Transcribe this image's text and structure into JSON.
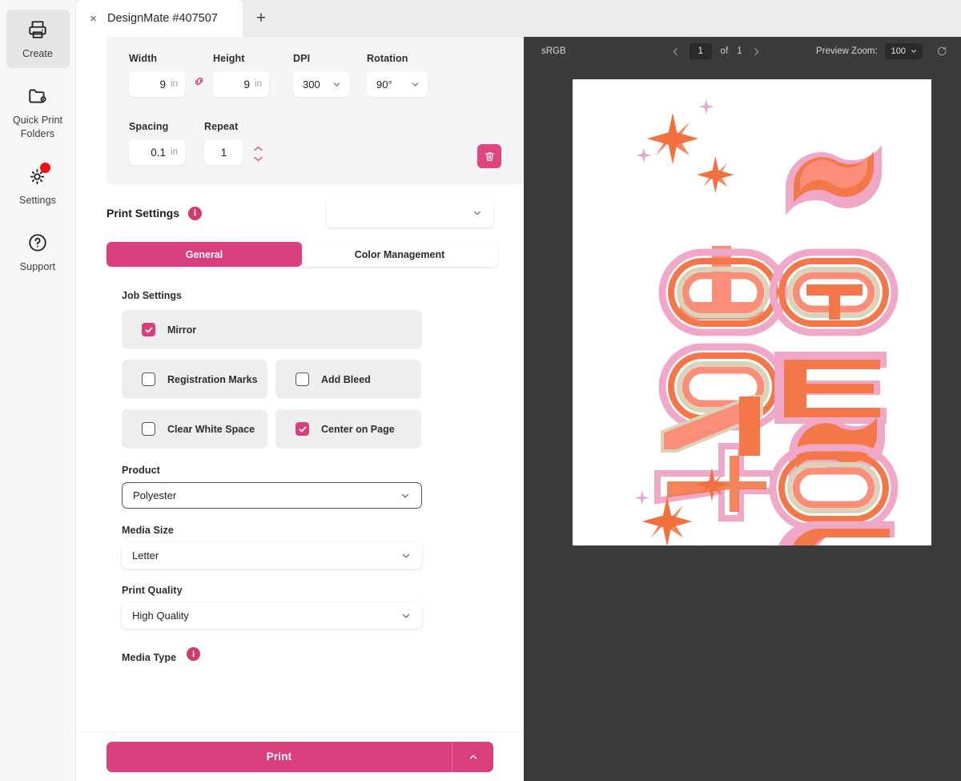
{
  "sidebar": {
    "items": [
      {
        "label": "Create",
        "icon": "printer-icon",
        "active": true,
        "badge": false
      },
      {
        "label": "Quick Print Folders",
        "icon": "folder-gear-icon",
        "active": false,
        "badge": false
      },
      {
        "label": "Settings",
        "icon": "gear-icon",
        "active": false,
        "badge": true
      },
      {
        "label": "Support",
        "icon": "question-circle-icon",
        "active": false,
        "badge": false
      }
    ]
  },
  "tabbar": {
    "tab_title": "DesignMate #407507",
    "close_glyph": "×",
    "new_tab_glyph": "+"
  },
  "dimensions": {
    "width": {
      "label": "Width",
      "value": "9",
      "unit": "in"
    },
    "height": {
      "label": "Height",
      "value": "9",
      "unit": "in"
    },
    "dpi": {
      "label": "DPI",
      "value": "300"
    },
    "rotation": {
      "label": "Rotation",
      "value": "90°"
    },
    "spacing": {
      "label": "Spacing",
      "value": "0.1",
      "unit": "in"
    },
    "repeat": {
      "label": "Repeat",
      "value": "1"
    },
    "link_icon": "link-chain-icon",
    "delete_icon": "trash-icon"
  },
  "print_settings": {
    "title": "Print Settings",
    "info_glyph": "i",
    "preset_value": "",
    "tabs": [
      {
        "label": "General",
        "active": true
      },
      {
        "label": "Color Management",
        "active": false
      }
    ]
  },
  "job_settings": {
    "title": "Job Settings",
    "options": [
      {
        "label": "Mirror",
        "checked": true
      },
      {
        "label": "Registration Marks",
        "checked": false
      },
      {
        "label": "Add Bleed",
        "checked": false
      },
      {
        "label": "Clear White Space",
        "checked": false
      },
      {
        "label": "Center on Page",
        "checked": true
      }
    ]
  },
  "fields": {
    "product": {
      "label": "Product",
      "value": "Polyester"
    },
    "media_size": {
      "label": "Media Size",
      "value": "Letter"
    },
    "print_quality": {
      "label": "Print Quality",
      "value": "High Quality"
    },
    "media_type": {
      "label": "Media Type",
      "info_glyph": "i"
    }
  },
  "footer": {
    "print_label": "Print",
    "caret_icon": "chevron-up-icon"
  },
  "preview": {
    "color_space": "sRGB",
    "page_current": "1",
    "page_of": "of",
    "page_total": "1",
    "prev_icon": "chevron-left-icon",
    "next_icon": "chevron-right-icon",
    "zoom_label": "Preview Zoom:",
    "zoom_value": "100",
    "reset_icon": "reset-rotate-icon",
    "artwork_description": "Mirrored retro 3D layered lettering with sparkle stars"
  },
  "colors": {
    "accent_pink": "#d93f7c",
    "accent_pink_dark": "#cf3a71",
    "badge_red": "#ee1111",
    "preview_bg": "#3b3b3b",
    "rail_bg": "#f7f7f7",
    "card_bg": "#f5f5f5",
    "chk_card_bg": "#eeeeee",
    "art_orange": "#f37748",
    "art_salmon": "#f98e76",
    "art_pink": "#f0a8c8",
    "art_lilac": "#e8b6e0",
    "art_cream": "#d9d3b8"
  }
}
